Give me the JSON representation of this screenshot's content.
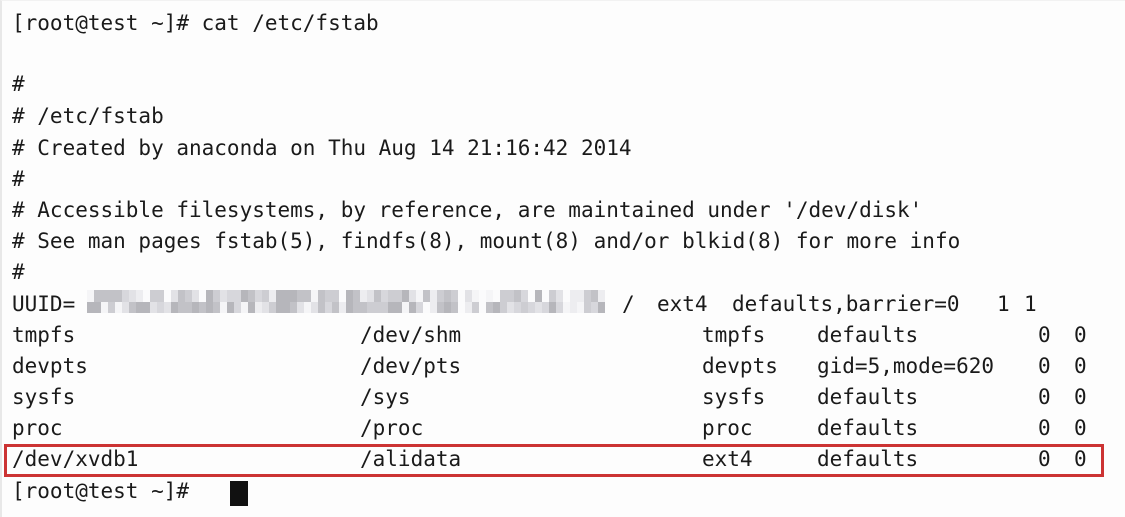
{
  "terminal": {
    "background_color": "#fdfdfd",
    "text_color": "#1a1a1a",
    "highlight_color": "#cc3333",
    "cursor_color": "#111111",
    "prompt": "[root@test ~]#",
    "command_line": "[root@test ~]# cat /etc/fstab",
    "command": "cat /etc/fstab",
    "final_prompt": "[root@test ~]#"
  },
  "file": {
    "path": "/etc/fstab",
    "comments": [
      "#",
      "# /etc/fstab",
      "# Created by anaconda on Thu Aug 14 21:16:42 2014",
      "#",
      "# Accessible filesystems, by reference, are maintained under '/dev/disk'",
      "# See man pages fstab(5), findfs(8), mount(8) and/or blkid(8) for more info",
      "#"
    ],
    "uuid_entry": {
      "device_label": "UUID=",
      "device_value_redacted": true,
      "mountpoint": "/",
      "fstype": "ext4",
      "options": "defaults,barrier=0",
      "dump": "1",
      "pass": "1"
    },
    "entries": [
      {
        "device": "tmpfs",
        "mountpoint": "/dev/shm",
        "fstype": "tmpfs",
        "options": "defaults",
        "dump": "0",
        "pass": "0",
        "highlighted": false
      },
      {
        "device": "devpts",
        "mountpoint": "/dev/pts",
        "fstype": "devpts",
        "options": "gid=5,mode=620",
        "dump": "0",
        "pass": "0",
        "highlighted": false
      },
      {
        "device": "sysfs",
        "mountpoint": "/sys",
        "fstype": "sysfs",
        "options": "defaults",
        "dump": "0",
        "pass": "0",
        "highlighted": false
      },
      {
        "device": "proc",
        "mountpoint": "/proc",
        "fstype": "proc",
        "options": "defaults",
        "dump": "0",
        "pass": "0",
        "highlighted": false
      },
      {
        "device": "/dev/xvdb1",
        "mountpoint": "/alidata",
        "fstype": "ext4",
        "options": "defaults",
        "dump": "0",
        "pass": "0",
        "highlighted": true
      }
    ]
  }
}
